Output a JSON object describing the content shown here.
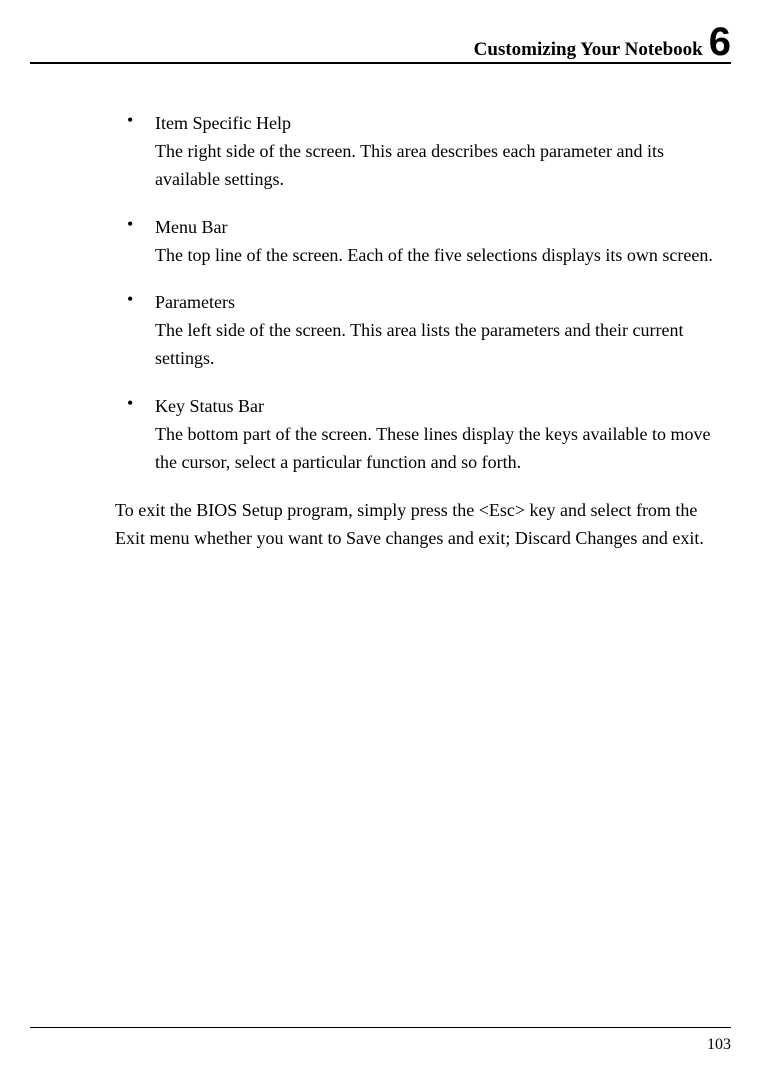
{
  "header": {
    "title": "Customizing Your Notebook",
    "chapter": "6"
  },
  "items": [
    {
      "title": "Item Specific Help",
      "desc": "The right side of the screen. This area describes each parameter and its available settings."
    },
    {
      "title": "Menu Bar",
      "desc": "The top line of the screen. Each of the five selections displays its own screen."
    },
    {
      "title": "Parameters",
      "desc": "The left side of the screen. This area lists the parameters and their current settings."
    },
    {
      "title": "Key Status Bar",
      "desc": "The bottom part of the screen. These lines display the keys available to move the cursor, select a particular function and so forth."
    }
  ],
  "closing": "To exit the BIOS Setup program, simply press the <Esc> key and select from the Exit menu whether you want to Save changes and exit; Discard Changes and exit.",
  "page_number": "103"
}
